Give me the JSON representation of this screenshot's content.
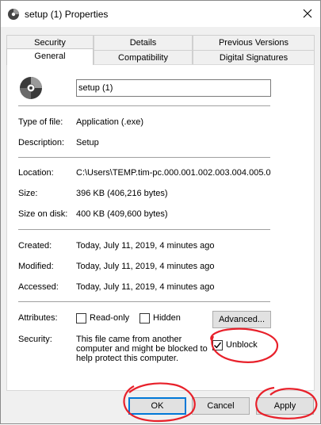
{
  "window": {
    "title": "setup (1) Properties",
    "icons": {
      "title": "cd-disc-icon",
      "close": "close-icon",
      "file": "cd-disc-icon"
    }
  },
  "tabs": {
    "row_back": [
      "Security",
      "Details",
      "Previous Versions"
    ],
    "row_front": [
      "General",
      "Compatibility",
      "Digital Signatures"
    ],
    "active": "General"
  },
  "general": {
    "file_name": "setup (1)",
    "type_label": "Type of file:",
    "type_value": "Application (.exe)",
    "desc_label": "Description:",
    "desc_value": "Setup",
    "location_label": "Location:",
    "location_value": "C:\\Users\\TEMP.tim-pc.000.001.002.003.004.005.000",
    "size_label": "Size:",
    "size_value": "396 KB (406,216 bytes)",
    "size_disk_label": "Size on disk:",
    "size_disk_value": "400 KB (409,600 bytes)",
    "created_label": "Created:",
    "created_value": "Today, July 11, 2019, 4 minutes ago",
    "modified_label": "Modified:",
    "modified_value": "Today, July 11, 2019, 4 minutes ago",
    "accessed_label": "Accessed:",
    "accessed_value": "Today, July 11, 2019, 4 minutes ago",
    "attributes_label": "Attributes:",
    "readonly_label": "Read-only",
    "readonly_checked": false,
    "hidden_label": "Hidden",
    "hidden_checked": false,
    "advanced_label": "Advanced...",
    "security_label": "Security:",
    "security_line1": "This file came from another",
    "security_line2": "computer and might be blocked to",
    "security_line3": "help protect this computer.",
    "unblock_label": "Unblock",
    "unblock_checked": true
  },
  "buttons": {
    "ok": "OK",
    "cancel": "Cancel",
    "apply": "Apply"
  },
  "colors": {
    "annotation_red": "#e8202a",
    "accent": "#0078d7"
  }
}
